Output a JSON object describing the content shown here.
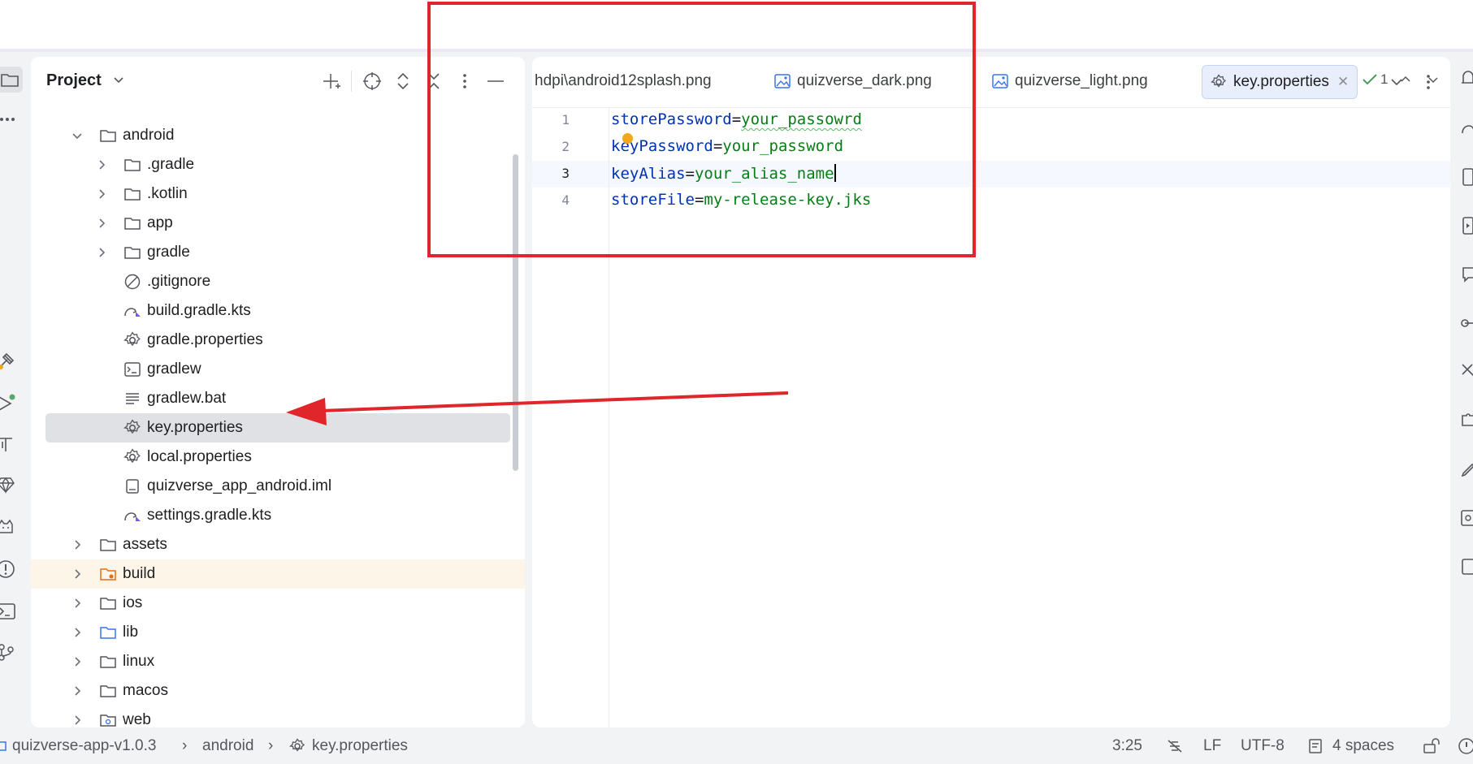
{
  "project_panel": {
    "title": "Project",
    "tree": [
      {
        "label": "android",
        "level": 0,
        "type": "folder",
        "state": "expanded"
      },
      {
        "label": ".gradle",
        "level": 1,
        "type": "folder",
        "state": "collapsed"
      },
      {
        "label": ".kotlin",
        "level": 1,
        "type": "folder",
        "state": "collapsed"
      },
      {
        "label": "app",
        "level": 1,
        "type": "folder",
        "state": "collapsed"
      },
      {
        "label": "gradle",
        "level": 1,
        "type": "folder",
        "state": "collapsed"
      },
      {
        "label": ".gitignore",
        "level": 1,
        "type": "ignore"
      },
      {
        "label": "build.gradle.kts",
        "level": 1,
        "type": "gradle"
      },
      {
        "label": "gradle.properties",
        "level": 1,
        "type": "properties"
      },
      {
        "label": "gradlew",
        "level": 1,
        "type": "shell"
      },
      {
        "label": "gradlew.bat",
        "level": 1,
        "type": "text"
      },
      {
        "label": "key.properties",
        "level": 1,
        "type": "properties",
        "selected": true
      },
      {
        "label": "local.properties",
        "level": 1,
        "type": "properties"
      },
      {
        "label": "quizverse_app_android.iml",
        "level": 1,
        "type": "iml"
      },
      {
        "label": "settings.gradle.kts",
        "level": 1,
        "type": "gradle"
      },
      {
        "label": "assets",
        "level": 0,
        "type": "folder",
        "state": "collapsed"
      },
      {
        "label": "build",
        "level": 0,
        "type": "folder-excluded",
        "state": "collapsed"
      },
      {
        "label": "ios",
        "level": 0,
        "type": "folder",
        "state": "collapsed"
      },
      {
        "label": "lib",
        "level": 0,
        "type": "folder-source",
        "state": "collapsed"
      },
      {
        "label": "linux",
        "level": 0,
        "type": "folder",
        "state": "collapsed"
      },
      {
        "label": "macos",
        "level": 0,
        "type": "folder",
        "state": "collapsed"
      },
      {
        "label": "web",
        "level": 0,
        "type": "folder-web",
        "state": "collapsed"
      }
    ]
  },
  "editor": {
    "tabs": [
      {
        "label": "hdpi\\android12splash.png",
        "icon": "image-icon",
        "active": false
      },
      {
        "label": "quizverse_dark.png",
        "icon": "image-icon",
        "active": false
      },
      {
        "label": "quizverse_light.png",
        "icon": "image-icon",
        "active": false
      },
      {
        "label": "key.properties",
        "icon": "settings-gear-icon",
        "active": true
      }
    ],
    "lines": [
      {
        "no": "1",
        "key": "storePassword",
        "sep": "=",
        "value": "your_passowrd",
        "typo": true
      },
      {
        "no": "2",
        "key": "keyPassword",
        "sep": "=",
        "value": "your_password"
      },
      {
        "no": "3",
        "key": "keyAlias",
        "sep": "=",
        "value": "your_alias_name",
        "current": true
      },
      {
        "no": "4",
        "key": "storeFile",
        "sep": "=",
        "value": "my-release-key.jks"
      }
    ],
    "inspection_count": "1"
  },
  "status_bar": {
    "breadcrumb": [
      "quizverse-app-v1.0.3",
      "android",
      "key.properties"
    ],
    "position": "3:25",
    "line_separator": "LF",
    "encoding": "UTF-8",
    "indent": "4 spaces"
  },
  "colors": {
    "annotation": "#e0262b",
    "keyword": "#0033b3",
    "value": "#067d17",
    "selection": "#dfe1e5"
  }
}
